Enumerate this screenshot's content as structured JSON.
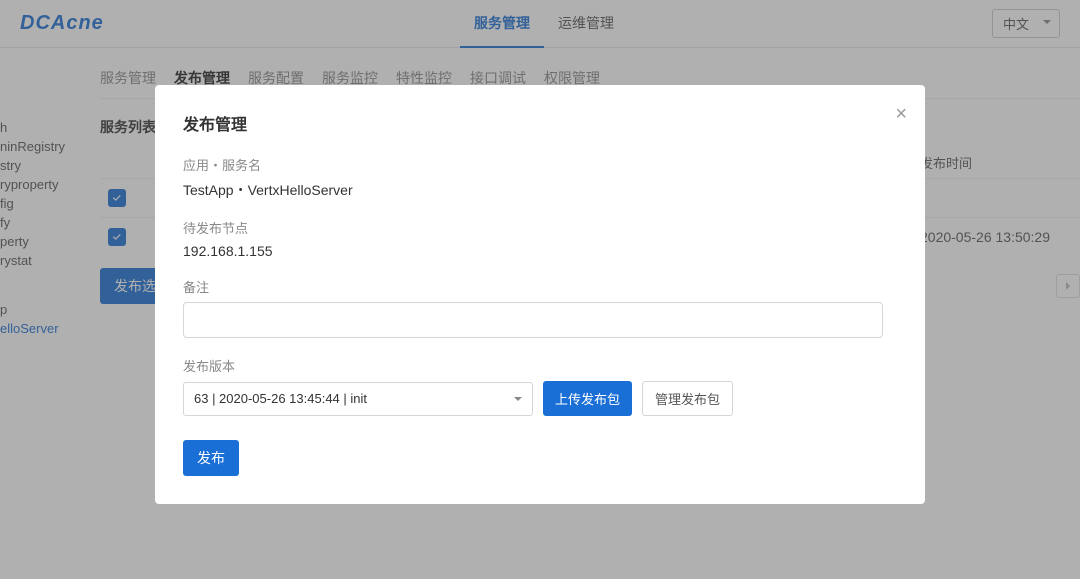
{
  "header": {
    "logo": "DCAcne",
    "nav": [
      "服务管理",
      "运维管理"
    ],
    "nav_active_index": 0,
    "lang_label": "中文"
  },
  "sidebar": {
    "items": [
      "h",
      "ninRegistry",
      "stry",
      "ryproperty",
      "fig",
      "fy",
      "perty",
      "rystat"
    ],
    "group2_label": "p",
    "group2_items": [
      "elloServer"
    ]
  },
  "tabs": {
    "items": [
      "服务管理",
      "发布管理",
      "服务配置",
      "服务监控",
      "特性监控",
      "接口调试",
      "权限管理"
    ],
    "active_index": 1
  },
  "list": {
    "title": "服务列表",
    "pub_time_header": "发布时间",
    "rows": [
      {
        "checked": true,
        "pub_time": ""
      },
      {
        "checked": true,
        "pub_time": "2020-05-26 13:50:29"
      }
    ]
  },
  "actions": {
    "publish_selected": "发布选中"
  },
  "modal": {
    "title": "发布管理",
    "app_service_label": "应用・服务名",
    "app_service_value": "TestApp・VertxHelloServer",
    "nodes_label": "待发布节点",
    "nodes_value": "192.168.1.155",
    "remark_label": "备注",
    "remark_value": "",
    "version_label": "发布版本",
    "version_selected": "63 | 2020-05-26 13:45:44 | init",
    "upload_label": "上传发布包",
    "manage_label": "管理发布包",
    "publish_label": "发布"
  }
}
